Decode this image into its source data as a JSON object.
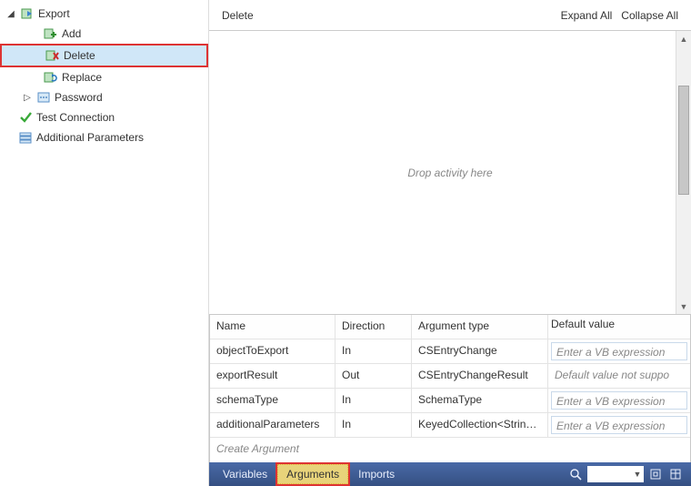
{
  "tree": {
    "export": "Export",
    "add": "Add",
    "delete": "Delete",
    "replace": "Replace",
    "password": "Password",
    "test_connection": "Test Connection",
    "additional_parameters": "Additional Parameters"
  },
  "designer": {
    "title": "Delete",
    "expand_all": "Expand All",
    "collapse_all": "Collapse All",
    "drop_hint": "Drop activity here"
  },
  "grid": {
    "headers": {
      "name": "Name",
      "direction": "Direction",
      "type": "Argument type",
      "default": "Default value"
    },
    "rows": [
      {
        "name": "objectToExport",
        "direction": "In",
        "type": "CSEntryChange",
        "default_kind": "vb",
        "default": "Enter a VB expression"
      },
      {
        "name": "exportResult",
        "direction": "Out",
        "type": "CSEntryChangeResult",
        "default_kind": "disabled",
        "default": "Default value not suppo"
      },
      {
        "name": "schemaType",
        "direction": "In",
        "type": "SchemaType",
        "default_kind": "vb",
        "default": "Enter a VB expression"
      },
      {
        "name": "additionalParameters",
        "direction": "In",
        "type": "KeyedCollection<String,Con",
        "default_kind": "vb",
        "default": "Enter a VB expression"
      }
    ],
    "create": "Create Argument"
  },
  "bottom": {
    "variables": "Variables",
    "arguments": "Arguments",
    "imports": "Imports"
  }
}
